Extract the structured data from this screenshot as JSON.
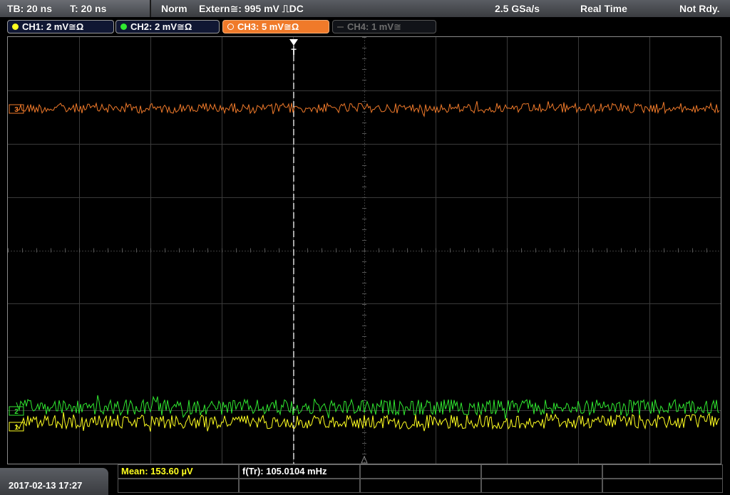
{
  "status": {
    "timebase": "TB: 20 ns",
    "trigger_time": "T: 20 ns",
    "mode": "Norm",
    "trigger_source": "Extern≅: 995 mV ⎍DC",
    "sample_rate": "2.5 GSa/s",
    "acquisition": "Real Time",
    "state": "Not Rdy."
  },
  "channels": [
    {
      "label": "CH1: 2 mV≅Ω",
      "color": "#ffff20",
      "active": true
    },
    {
      "label": "CH2: 2 mV≅Ω",
      "color": "#30e830",
      "active": true
    },
    {
      "label": "CH3: 5 mV≅Ω",
      "color": "#f07a2a",
      "active": true,
      "selected": true
    },
    {
      "label": "CH4: 1 mV≅",
      "color": "#6d6d6d",
      "active": false
    }
  ],
  "markers": {
    "trigger": "T",
    "ch1": "1",
    "ch2": "2",
    "ch3": "3"
  },
  "measurements": {
    "mean": "Mean: 153.60 µV",
    "freq": "f(Tr): 105.0104 mHz"
  },
  "timestamp": "2017-02-13 17:27"
}
